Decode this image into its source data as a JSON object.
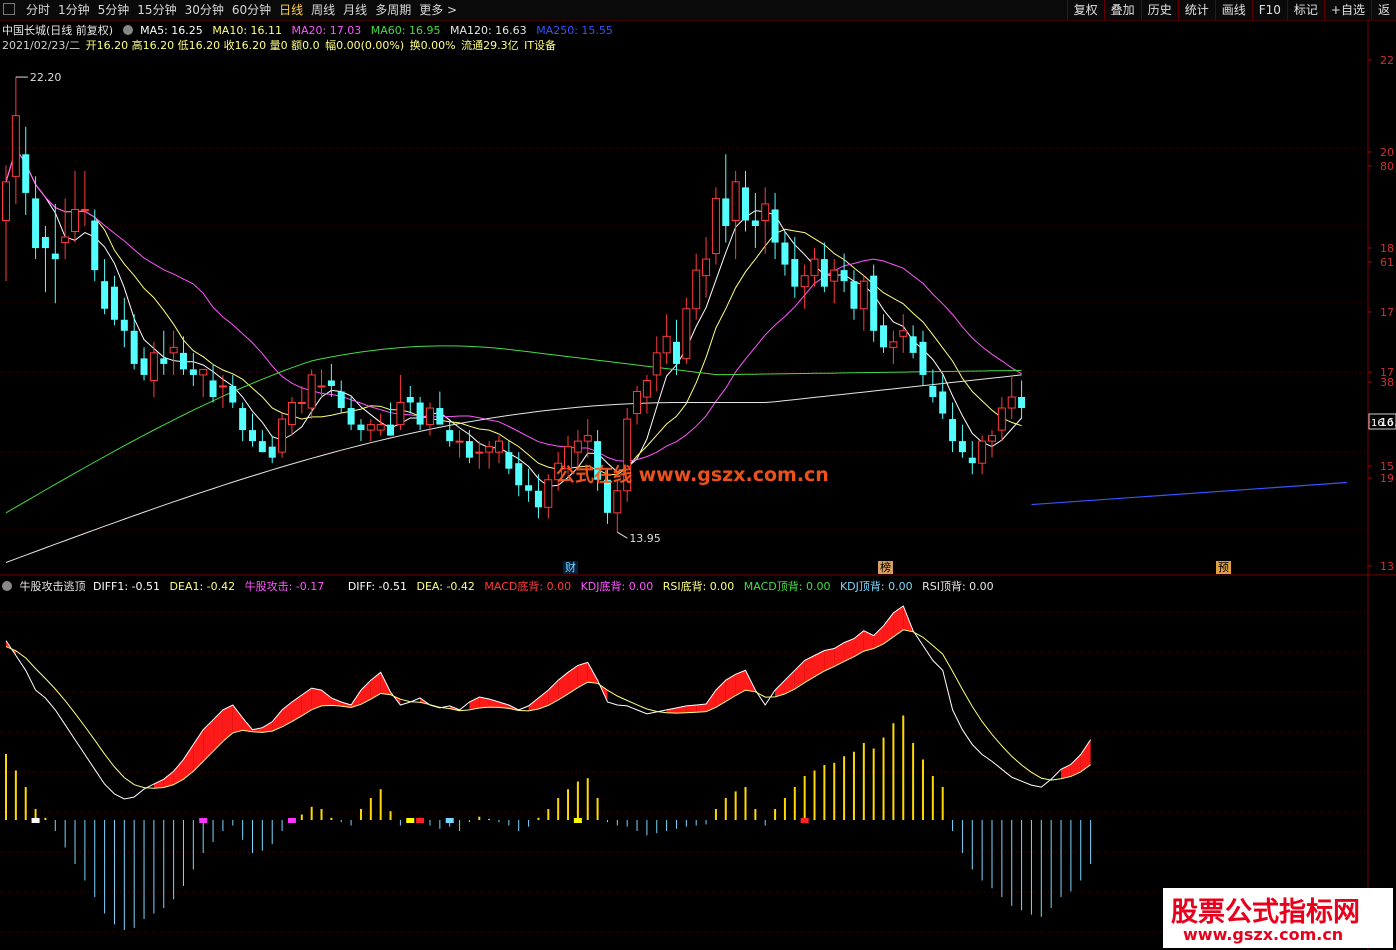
{
  "toolbar": {
    "periods": [
      "分时",
      "1分钟",
      "5分钟",
      "15分钟",
      "30分钟",
      "60分钟",
      "日线",
      "周线",
      "月线",
      "多周期",
      "更多 >"
    ],
    "active_period": "日线",
    "tools": [
      "复权",
      "叠加",
      "历史",
      "统计",
      "画线",
      "F10",
      "标记",
      "+自选",
      "返"
    ]
  },
  "header": {
    "title": "中国长城(日线 前复权)",
    "ma5": "MA5: 16.25",
    "ma10": "MA10: 16.11",
    "ma20": "MA20: 17.03",
    "ma60": "MA60: 16.95",
    "ma120": "MA120: 16.63",
    "ma250": "MA250: 15.55",
    "date": "2021/02/23/二",
    "open": "开16.20",
    "high": "高16.20",
    "low": "低16.20",
    "close": "收16.20",
    "vol": "量0",
    "amt": "额0.0",
    "range": "幅0.00(0.00%)",
    "turnover": "换0.00%",
    "float": "流通29.3亿",
    "sector": "IT设备"
  },
  "price_labels": {
    "high": "22.20",
    "low": "13.95",
    "current": "16.0"
  },
  "right_axis": [
    "22",
    "20",
    "80",
    "18",
    "61",
    "17",
    "17",
    "38",
    "16.0",
    "15",
    "19",
    "13"
  ],
  "event_tags": [
    "财",
    "榜",
    "预"
  ],
  "indicator": {
    "name": "牛股攻击逃顶",
    "diff1": "DIFF1: -0.51",
    "dea1": "DEA1: -0.42",
    "attack": "牛股攻击: -0.17",
    "diff": "DIFF: -0.51",
    "dea": "DEA: -0.42",
    "macd_bottom": "MACD底背: 0.00",
    "kdj_bottom": "KDJ底背: 0.00",
    "rsi_bottom": "RSI底背: 0.00",
    "macd_top": "MACD顶背: 0.00",
    "kdj_top": "KDJ顶背: 0.00",
    "rsi_top": "RSI顶背: 0.00"
  },
  "watermarks": {
    "center": "公式在线 www.gszx.com.cn",
    "corner_main": "股票公式指标网",
    "corner_url": "www.gszx.com.cn"
  },
  "colors": {
    "up": "#ff3b3b",
    "down": "#54ffff",
    "ma5": "#ffffff",
    "ma10": "#ffff80",
    "ma20": "#ff55ff",
    "ma60": "#44dd44",
    "ma120": "#e6e6e6",
    "ma250": "#3355ff",
    "macd_pos": "#ffd800",
    "macd_neg": "#7ad6ff"
  },
  "chart_data": {
    "type": "candlestick",
    "series": [
      {
        "o": 19.6,
        "h": 20.6,
        "l": 18.5,
        "c": 20.3
      },
      {
        "o": 20.4,
        "h": 22.2,
        "l": 19.9,
        "c": 21.5
      },
      {
        "o": 20.8,
        "h": 21.3,
        "l": 19.7,
        "c": 20.1
      },
      {
        "o": 20.0,
        "h": 20.4,
        "l": 18.9,
        "c": 19.1
      },
      {
        "o": 19.3,
        "h": 19.5,
        "l": 18.3,
        "c": 19.1
      },
      {
        "o": 19.0,
        "h": 19.9,
        "l": 18.1,
        "c": 18.9
      },
      {
        "o": 19.2,
        "h": 20.0,
        "l": 18.9,
        "c": 19.3
      },
      {
        "o": 19.4,
        "h": 20.5,
        "l": 19.2,
        "c": 19.8
      },
      {
        "o": 19.8,
        "h": 20.5,
        "l": 19.5,
        "c": 19.8
      },
      {
        "o": 19.6,
        "h": 19.8,
        "l": 18.5,
        "c": 18.7
      },
      {
        "o": 18.5,
        "h": 18.9,
        "l": 17.9,
        "c": 18.0
      },
      {
        "o": 18.4,
        "h": 18.6,
        "l": 17.7,
        "c": 17.8
      },
      {
        "o": 17.8,
        "h": 18.2,
        "l": 17.3,
        "c": 17.6
      },
      {
        "o": 17.6,
        "h": 17.9,
        "l": 16.9,
        "c": 17.0
      },
      {
        "o": 17.1,
        "h": 17.3,
        "l": 16.7,
        "c": 16.8
      },
      {
        "o": 16.7,
        "h": 17.4,
        "l": 16.4,
        "c": 17.2
      },
      {
        "o": 17.1,
        "h": 17.6,
        "l": 16.8,
        "c": 17.0
      },
      {
        "o": 17.2,
        "h": 17.6,
        "l": 16.8,
        "c": 17.3
      },
      {
        "o": 17.2,
        "h": 17.5,
        "l": 16.8,
        "c": 16.9
      },
      {
        "o": 16.9,
        "h": 17.2,
        "l": 16.6,
        "c": 16.8
      },
      {
        "o": 16.8,
        "h": 16.9,
        "l": 16.4,
        "c": 16.9
      },
      {
        "o": 16.7,
        "h": 17.0,
        "l": 16.3,
        "c": 16.4
      },
      {
        "o": 16.6,
        "h": 16.8,
        "l": 16.2,
        "c": 16.6
      },
      {
        "o": 16.6,
        "h": 16.8,
        "l": 16.2,
        "c": 16.3
      },
      {
        "o": 16.2,
        "h": 16.3,
        "l": 15.6,
        "c": 15.8
      },
      {
        "o": 15.8,
        "h": 16.1,
        "l": 15.5,
        "c": 15.6
      },
      {
        "o": 15.6,
        "h": 15.8,
        "l": 15.4,
        "c": 15.4
      },
      {
        "o": 15.5,
        "h": 15.7,
        "l": 15.2,
        "c": 15.3
      },
      {
        "o": 15.4,
        "h": 16.1,
        "l": 15.3,
        "c": 16.0
      },
      {
        "o": 15.9,
        "h": 16.4,
        "l": 15.7,
        "c": 16.3
      },
      {
        "o": 16.3,
        "h": 16.6,
        "l": 16.1,
        "c": 16.3
      },
      {
        "o": 16.2,
        "h": 16.9,
        "l": 16.0,
        "c": 16.8
      },
      {
        "o": 16.6,
        "h": 16.9,
        "l": 16.4,
        "c": 16.6
      },
      {
        "o": 16.7,
        "h": 17.0,
        "l": 16.4,
        "c": 16.6
      },
      {
        "o": 16.5,
        "h": 16.7,
        "l": 16.1,
        "c": 16.2
      },
      {
        "o": 16.2,
        "h": 16.4,
        "l": 15.8,
        "c": 15.9
      },
      {
        "o": 15.9,
        "h": 16.0,
        "l": 15.6,
        "c": 15.8
      },
      {
        "o": 15.8,
        "h": 16.0,
        "l": 15.6,
        "c": 15.9
      },
      {
        "o": 15.8,
        "h": 16.1,
        "l": 15.7,
        "c": 15.9
      },
      {
        "o": 15.9,
        "h": 16.3,
        "l": 15.7,
        "c": 15.7
      },
      {
        "o": 15.9,
        "h": 16.8,
        "l": 15.8,
        "c": 16.3
      },
      {
        "o": 16.4,
        "h": 16.6,
        "l": 16.1,
        "c": 16.3
      },
      {
        "o": 16.3,
        "h": 16.4,
        "l": 15.8,
        "c": 15.9
      },
      {
        "o": 15.9,
        "h": 16.3,
        "l": 15.7,
        "c": 16.2
      },
      {
        "o": 16.2,
        "h": 16.5,
        "l": 15.9,
        "c": 15.9
      },
      {
        "o": 15.8,
        "h": 16.0,
        "l": 15.5,
        "c": 15.6
      },
      {
        "o": 15.6,
        "h": 15.8,
        "l": 15.3,
        "c": 15.6
      },
      {
        "o": 15.6,
        "h": 15.8,
        "l": 15.2,
        "c": 15.3
      },
      {
        "o": 15.4,
        "h": 15.6,
        "l": 15.1,
        "c": 15.4
      },
      {
        "o": 15.4,
        "h": 15.6,
        "l": 15.1,
        "c": 15.5
      },
      {
        "o": 15.4,
        "h": 15.7,
        "l": 15.2,
        "c": 15.6
      },
      {
        "o": 15.4,
        "h": 15.6,
        "l": 15.0,
        "c": 15.1
      },
      {
        "o": 15.2,
        "h": 15.4,
        "l": 14.6,
        "c": 14.8
      },
      {
        "o": 14.8,
        "h": 15.1,
        "l": 14.5,
        "c": 14.7
      },
      {
        "o": 14.7,
        "h": 15.0,
        "l": 14.2,
        "c": 14.4
      },
      {
        "o": 14.4,
        "h": 15.0,
        "l": 14.2,
        "c": 14.9
      },
      {
        "o": 14.9,
        "h": 15.4,
        "l": 14.7,
        "c": 15.2
      },
      {
        "o": 15.1,
        "h": 15.7,
        "l": 15.0,
        "c": 15.5
      },
      {
        "o": 15.4,
        "h": 15.8,
        "l": 15.1,
        "c": 15.6
      },
      {
        "o": 15.6,
        "h": 16.0,
        "l": 15.3,
        "c": 15.7
      },
      {
        "o": 15.6,
        "h": 15.8,
        "l": 14.7,
        "c": 14.9
      },
      {
        "o": 14.9,
        "h": 15.1,
        "l": 14.1,
        "c": 14.3
      },
      {
        "o": 14.3,
        "h": 14.9,
        "l": 13.95,
        "c": 14.7
      },
      {
        "o": 14.7,
        "h": 16.2,
        "l": 14.5,
        "c": 16.0
      },
      {
        "o": 16.1,
        "h": 16.6,
        "l": 15.9,
        "c": 16.5
      },
      {
        "o": 16.4,
        "h": 16.8,
        "l": 16.1,
        "c": 16.7
      },
      {
        "o": 16.8,
        "h": 17.5,
        "l": 16.5,
        "c": 17.2
      },
      {
        "o": 17.2,
        "h": 17.9,
        "l": 17.0,
        "c": 17.5
      },
      {
        "o": 17.4,
        "h": 17.8,
        "l": 16.8,
        "c": 17.0
      },
      {
        "o": 17.1,
        "h": 18.2,
        "l": 17.0,
        "c": 18.0
      },
      {
        "o": 18.0,
        "h": 19.0,
        "l": 17.8,
        "c": 18.7
      },
      {
        "o": 18.6,
        "h": 19.3,
        "l": 18.2,
        "c": 18.9
      },
      {
        "o": 19.0,
        "h": 20.2,
        "l": 18.8,
        "c": 20.0
      },
      {
        "o": 20.0,
        "h": 20.8,
        "l": 19.2,
        "c": 19.5
      },
      {
        "o": 19.6,
        "h": 20.5,
        "l": 18.9,
        "c": 20.3
      },
      {
        "o": 20.2,
        "h": 20.5,
        "l": 19.4,
        "c": 19.6
      },
      {
        "o": 19.6,
        "h": 20.1,
        "l": 19.1,
        "c": 19.5
      },
      {
        "o": 19.6,
        "h": 20.2,
        "l": 19.0,
        "c": 19.9
      },
      {
        "o": 19.8,
        "h": 20.1,
        "l": 18.9,
        "c": 19.2
      },
      {
        "o": 19.2,
        "h": 19.4,
        "l": 18.6,
        "c": 18.8
      },
      {
        "o": 18.9,
        "h": 19.3,
        "l": 18.2,
        "c": 18.4
      },
      {
        "o": 18.4,
        "h": 18.8,
        "l": 18.0,
        "c": 18.6
      },
      {
        "o": 18.6,
        "h": 19.1,
        "l": 18.4,
        "c": 18.9
      },
      {
        "o": 18.9,
        "h": 19.2,
        "l": 18.3,
        "c": 18.4
      },
      {
        "o": 18.5,
        "h": 18.9,
        "l": 18.1,
        "c": 18.7
      },
      {
        "o": 18.7,
        "h": 19.0,
        "l": 18.3,
        "c": 18.5
      },
      {
        "o": 18.5,
        "h": 18.7,
        "l": 17.8,
        "c": 18.0
      },
      {
        "o": 18.0,
        "h": 18.6,
        "l": 17.6,
        "c": 18.5
      },
      {
        "o": 18.6,
        "h": 18.8,
        "l": 17.4,
        "c": 17.6
      },
      {
        "o": 17.7,
        "h": 17.9,
        "l": 17.2,
        "c": 17.3
      },
      {
        "o": 17.3,
        "h": 17.6,
        "l": 17.0,
        "c": 17.4
      },
      {
        "o": 17.5,
        "h": 17.9,
        "l": 17.2,
        "c": 17.6
      },
      {
        "o": 17.5,
        "h": 17.7,
        "l": 17.1,
        "c": 17.2
      },
      {
        "o": 17.4,
        "h": 17.6,
        "l": 16.6,
        "c": 16.8
      },
      {
        "o": 16.6,
        "h": 16.9,
        "l": 16.3,
        "c": 16.4
      },
      {
        "o": 16.5,
        "h": 16.8,
        "l": 16.0,
        "c": 16.1
      },
      {
        "o": 16.0,
        "h": 16.3,
        "l": 15.4,
        "c": 15.6
      },
      {
        "o": 15.6,
        "h": 15.9,
        "l": 15.3,
        "c": 15.4
      },
      {
        "o": 15.3,
        "h": 15.6,
        "l": 15.0,
        "c": 15.2
      },
      {
        "o": 15.2,
        "h": 15.7,
        "l": 15.0,
        "c": 15.6
      },
      {
        "o": 15.6,
        "h": 15.8,
        "l": 15.3,
        "c": 15.7
      },
      {
        "o": 15.8,
        "h": 16.4,
        "l": 15.6,
        "c": 16.2
      },
      {
        "o": 16.2,
        "h": 16.8,
        "l": 16.0,
        "c": 16.4
      },
      {
        "o": 16.4,
        "h": 16.7,
        "l": 16.0,
        "c": 16.2
      }
    ],
    "macd_hist": [
      0.6,
      0.45,
      0.3,
      0.1,
      0.02,
      -0.1,
      -0.25,
      -0.4,
      -0.55,
      -0.7,
      -0.85,
      -0.95,
      -1.0,
      -0.98,
      -0.9,
      -0.85,
      -0.8,
      -0.72,
      -0.6,
      -0.45,
      -0.3,
      -0.2,
      -0.1,
      -0.05,
      -0.18,
      -0.3,
      -0.28,
      -0.22,
      -0.1,
      -0.02,
      0.05,
      0.12,
      0.1,
      0.02,
      -0.02,
      -0.05,
      0.1,
      0.2,
      0.28,
      0.08,
      -0.05,
      -0.02,
      0.02,
      -0.05,
      -0.08,
      -0.06,
      -0.1,
      -0.02,
      0.03,
      0.01,
      -0.02,
      -0.05,
      -0.1,
      -0.06,
      0.02,
      0.1,
      0.2,
      0.28,
      0.35,
      0.38,
      0.2,
      -0.02,
      -0.05,
      -0.06,
      -0.1,
      -0.14,
      -0.12,
      -0.1,
      -0.08,
      -0.06,
      -0.05,
      -0.04,
      0.1,
      0.2,
      0.26,
      0.3,
      0.1,
      -0.05,
      0.1,
      0.2,
      0.3,
      0.4,
      0.45,
      0.5,
      0.52,
      0.58,
      0.62,
      0.7,
      0.65,
      0.75,
      0.88,
      0.95,
      0.7,
      0.55,
      0.4,
      0.3,
      -0.1,
      -0.3,
      -0.45,
      -0.55,
      -0.62,
      -0.7,
      -0.78,
      -0.82,
      -0.86,
      -0.88,
      -0.8,
      -0.7,
      -0.65,
      -0.55,
      -0.4
    ],
    "right_axis_ticks": [
      "22",
      "20",
      "80",
      "18",
      "61",
      "17",
      "17",
      "38",
      "16.0",
      "15",
      "19",
      "13"
    ]
  }
}
